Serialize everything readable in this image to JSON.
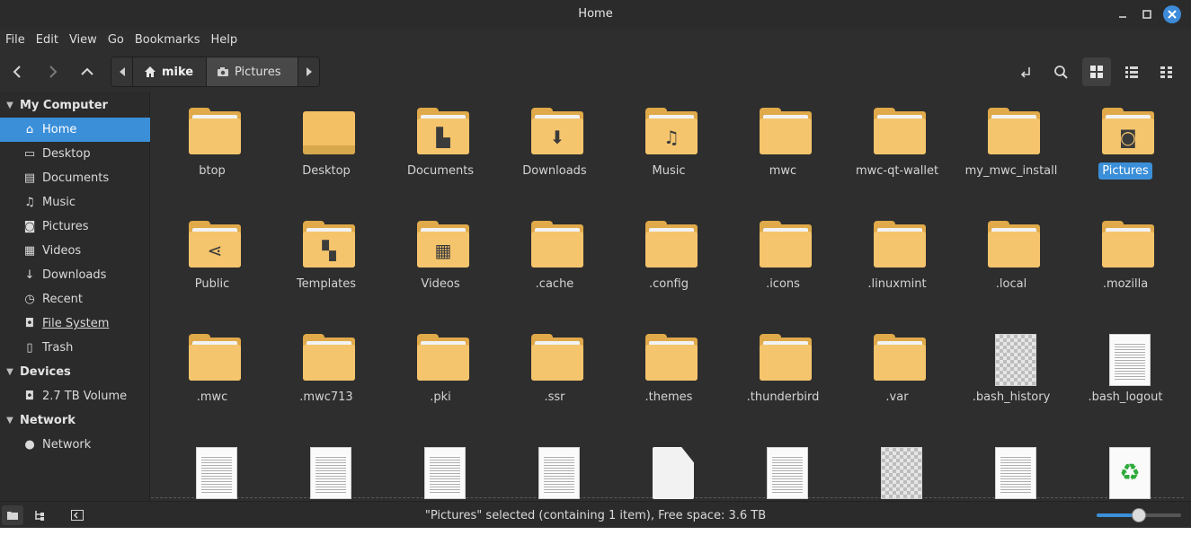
{
  "window": {
    "title": "Home"
  },
  "menu": [
    "File",
    "Edit",
    "View",
    "Go",
    "Bookmarks",
    "Help"
  ],
  "toolbar": {
    "back_icon": "chevron-left-icon",
    "forward_icon": "chevron-right-icon",
    "up_icon": "chevron-up-icon",
    "breadcrumbs": [
      {
        "label": "mike",
        "icon": "home-icon"
      },
      {
        "label": "Pictures",
        "icon": "camera-icon"
      }
    ]
  },
  "sidebar": {
    "sections": [
      {
        "title": "My Computer",
        "items": [
          {
            "label": "Home",
            "icon": "home-icon",
            "active": true
          },
          {
            "label": "Desktop",
            "icon": "desktop-icon"
          },
          {
            "label": "Documents",
            "icon": "document-icon"
          },
          {
            "label": "Music",
            "icon": "music-icon"
          },
          {
            "label": "Pictures",
            "icon": "camera-icon"
          },
          {
            "label": "Videos",
            "icon": "film-icon"
          },
          {
            "label": "Downloads",
            "icon": "download-icon"
          },
          {
            "label": "Recent",
            "icon": "clock-icon"
          },
          {
            "label": "File System",
            "icon": "drive-icon"
          },
          {
            "label": "Trash",
            "icon": "trash-icon"
          }
        ]
      },
      {
        "title": "Devices",
        "items": [
          {
            "label": "2.7 TB Volume",
            "icon": "drive-icon"
          }
        ]
      },
      {
        "title": "Network",
        "items": [
          {
            "label": "Network",
            "icon": "globe-icon"
          }
        ]
      }
    ]
  },
  "files": [
    {
      "name": "btop",
      "kind": "folder"
    },
    {
      "name": "Desktop",
      "kind": "desktop-folder"
    },
    {
      "name": "Documents",
      "kind": "folder",
      "emblem": "document-icon"
    },
    {
      "name": "Downloads",
      "kind": "folder",
      "emblem": "download-icon"
    },
    {
      "name": "Music",
      "kind": "folder",
      "emblem": "music-icon"
    },
    {
      "name": "mwc",
      "kind": "folder"
    },
    {
      "name": "mwc-qt-wallet",
      "kind": "folder"
    },
    {
      "name": "my_mwc_install",
      "kind": "folder"
    },
    {
      "name": "Pictures",
      "kind": "folder",
      "emblem": "camera-icon",
      "selected": true
    },
    {
      "name": "Public",
      "kind": "folder",
      "emblem": "share-icon"
    },
    {
      "name": "Templates",
      "kind": "folder",
      "emblem": "template-icon"
    },
    {
      "name": "Videos",
      "kind": "folder",
      "emblem": "film-icon"
    },
    {
      "name": ".cache",
      "kind": "folder"
    },
    {
      "name": ".config",
      "kind": "folder"
    },
    {
      "name": ".icons",
      "kind": "folder"
    },
    {
      "name": ".linuxmint",
      "kind": "folder"
    },
    {
      "name": ".local",
      "kind": "folder"
    },
    {
      "name": ".mozilla",
      "kind": "folder"
    },
    {
      "name": ".mwc",
      "kind": "folder"
    },
    {
      "name": ".mwc713",
      "kind": "folder"
    },
    {
      "name": ".pki",
      "kind": "folder"
    },
    {
      "name": ".ssr",
      "kind": "folder"
    },
    {
      "name": ".themes",
      "kind": "folder"
    },
    {
      "name": ".thunderbird",
      "kind": "folder"
    },
    {
      "name": ".var",
      "kind": "folder"
    },
    {
      "name": ".bash_history",
      "kind": "checker-file"
    },
    {
      "name": ".bash_logout",
      "kind": "text-file"
    },
    {
      "name": "",
      "kind": "text-file"
    },
    {
      "name": "",
      "kind": "text-file"
    },
    {
      "name": "",
      "kind": "text-file"
    },
    {
      "name": "",
      "kind": "text-file"
    },
    {
      "name": "",
      "kind": "blank-file"
    },
    {
      "name": "",
      "kind": "text-file"
    },
    {
      "name": "",
      "kind": "checker-file"
    },
    {
      "name": "",
      "kind": "text-file"
    },
    {
      "name": "",
      "kind": "recycle-file"
    }
  ],
  "statusbar": {
    "text": "\"Pictures\" selected (containing 1 item), Free space: 3.6 TB",
    "zoom_level": 0.5
  },
  "colors": {
    "accent": "#3b8fd8",
    "folder": "#f5c56d"
  }
}
